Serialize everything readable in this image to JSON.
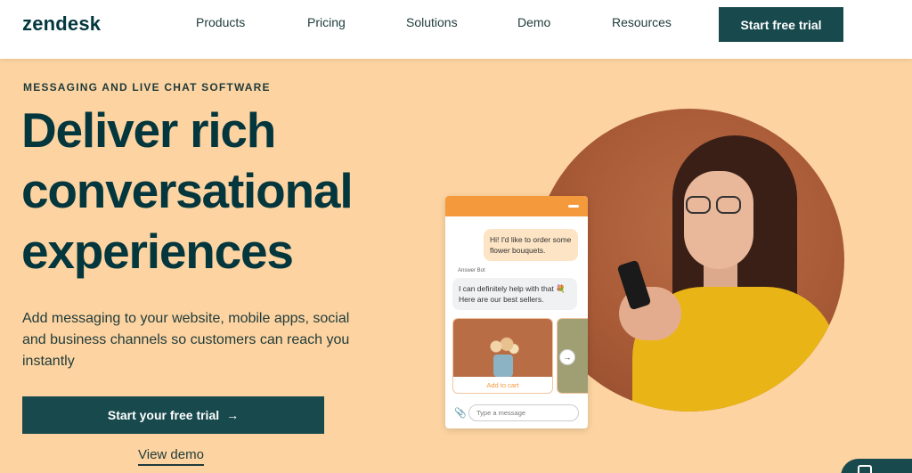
{
  "header": {
    "logo": "zendesk",
    "nav": [
      "Products",
      "Pricing",
      "Solutions",
      "Demo",
      "Resources"
    ],
    "cta": "Start free trial"
  },
  "hero": {
    "eyebrow": "MESSAGING AND LIVE CHAT SOFTWARE",
    "headline_lines": [
      "Deliver rich",
      "conversational",
      "experiences"
    ],
    "subhead": "Add messaging to your website, mobile apps, social and business channels so customers can reach you instantly",
    "primary_button": "Start your free trial",
    "primary_button_icon": "arrow-right-icon",
    "secondary_link": "View demo"
  },
  "chat_widget": {
    "user_message": "Hi! I'd like to order some flower bouquets.",
    "bot_label": "Answer Bot",
    "bot_message": "I can definitely help with that 💐 Here are our best sellers.",
    "card_action": "Add to cart",
    "input_placeholder": "Type a message"
  },
  "colors": {
    "background": "#fdd4a1",
    "brand_dark": "#17494d",
    "chat_accent": "#f5993d"
  }
}
